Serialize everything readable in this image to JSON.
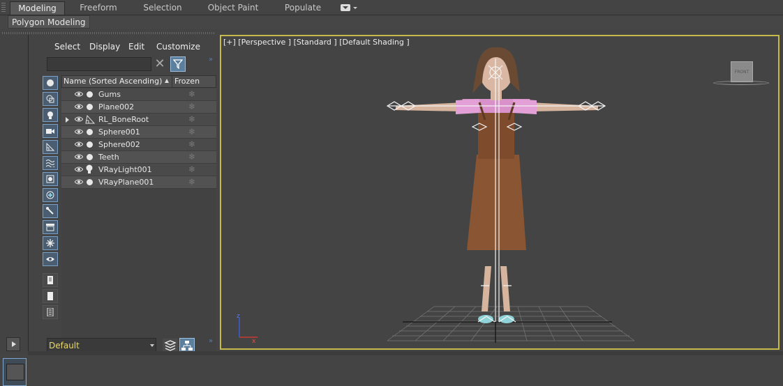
{
  "ribbon": {
    "tabs": [
      {
        "label": "Modeling",
        "active": true
      },
      {
        "label": "Freeform",
        "active": false
      },
      {
        "label": "Selection",
        "active": false
      },
      {
        "label": "Object Paint",
        "active": false
      },
      {
        "label": "Populate",
        "active": false
      }
    ],
    "sub_tab": "Polygon Modeling"
  },
  "scene_explorer": {
    "menu": [
      "Select",
      "Display",
      "Edit",
      "Customize"
    ],
    "search_value": "",
    "columns": {
      "name": "Name (Sorted Ascending)",
      "frozen": "Frozen"
    },
    "rows": [
      {
        "name": "Gums",
        "type": "geometry"
      },
      {
        "name": "Plane002",
        "type": "geometry"
      },
      {
        "name": "RL_BoneRoot",
        "type": "bone",
        "expandable": true
      },
      {
        "name": "Sphere001",
        "type": "geometry"
      },
      {
        "name": "Sphere002",
        "type": "geometry"
      },
      {
        "name": "Teeth",
        "type": "geometry"
      },
      {
        "name": "VRayLight001",
        "type": "light"
      },
      {
        "name": "VRayPlane001",
        "type": "geometry"
      }
    ],
    "layer": "Default"
  },
  "viewport": {
    "label": "[+] [Perspective ] [Standard ] [Default Shading ]",
    "viewcube_face": "FRONT",
    "active_border_color": "#c7b94a"
  },
  "icons": [
    "eye-icon",
    "sphere-icon",
    "freeze-icon",
    "filter-icon",
    "play-icon",
    "layers-icon",
    "hierarchy-icon",
    "bone-icon",
    "light-bulb-icon"
  ]
}
